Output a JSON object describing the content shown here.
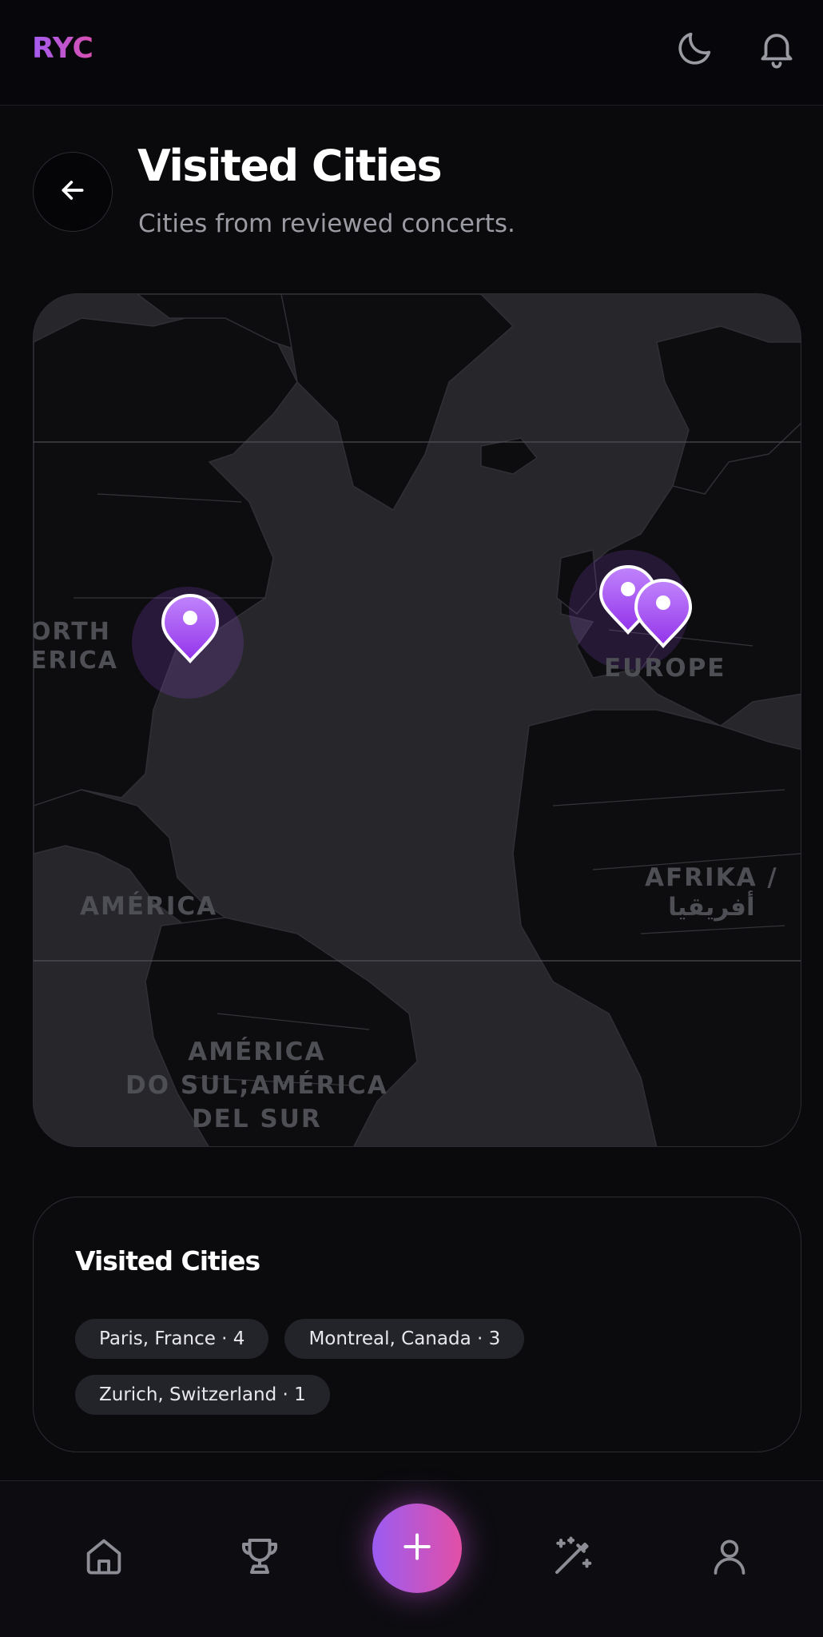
{
  "app": {
    "logo": "RYC"
  },
  "header": {
    "title": "Visited Cities",
    "subtitle": "Cities from reviewed concerts."
  },
  "map": {
    "labels": {
      "north_america_line1": "ORTH",
      "north_america_line2": "ERICA",
      "america": "AMÉRICA",
      "europe": "EUROPE",
      "africa_line1": "AFRIKA /",
      "africa_line2": "أفريقيا",
      "south_america_line1": "AMÉRICA",
      "south_america_line2": "DO SUL;AMÉRICA",
      "south_america_line3": "DEL SUR"
    },
    "pin_color": "#a855f7"
  },
  "cities": {
    "title": "Visited Cities",
    "items": [
      {
        "label": "Paris, France · 4"
      },
      {
        "label": "Montreal, Canada · 3"
      },
      {
        "label": "Zurich, Switzerland · 1"
      }
    ]
  },
  "nav": {
    "items": [
      "home-icon",
      "trophy-icon",
      "plus-icon",
      "magic-wand-icon",
      "user-icon"
    ],
    "accent_start": "#9b5cf2",
    "accent_end": "#e24fa6"
  }
}
